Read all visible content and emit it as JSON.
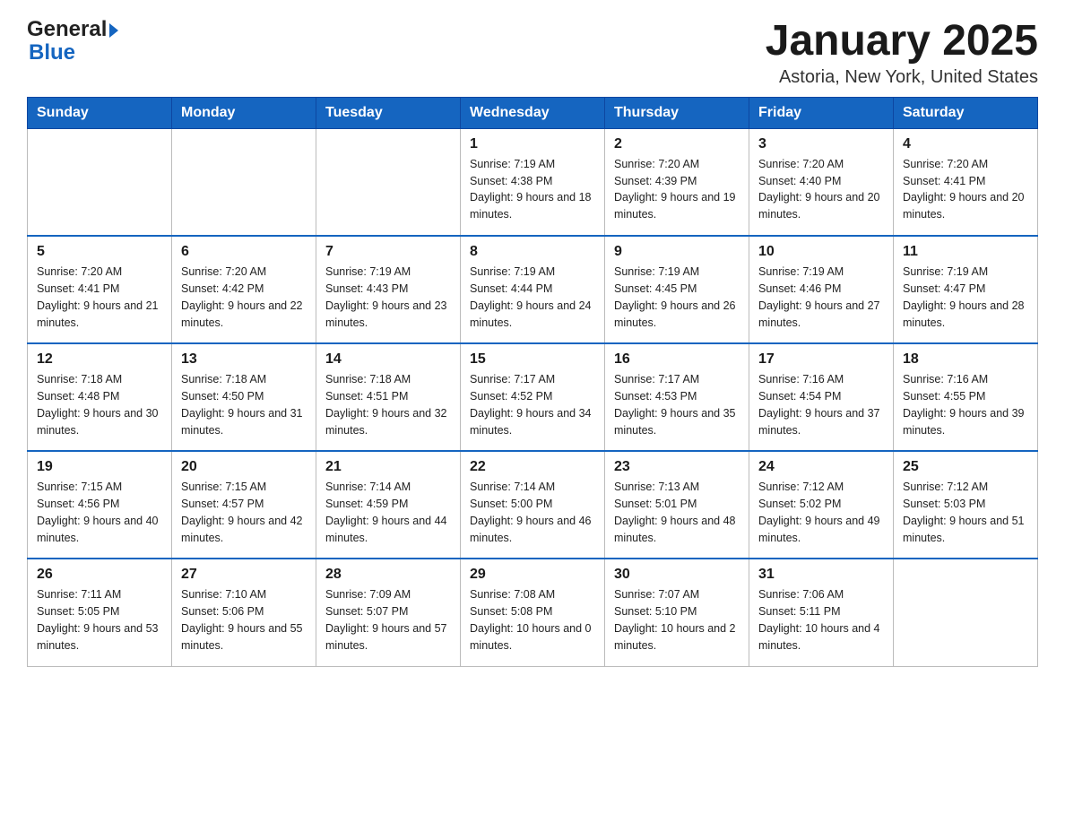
{
  "header": {
    "logo_line1": "General",
    "logo_line2": "Blue",
    "month_title": "January 2025",
    "location": "Astoria, New York, United States"
  },
  "days_of_week": [
    "Sunday",
    "Monday",
    "Tuesday",
    "Wednesday",
    "Thursday",
    "Friday",
    "Saturday"
  ],
  "weeks": [
    [
      {
        "day": "",
        "info": ""
      },
      {
        "day": "",
        "info": ""
      },
      {
        "day": "",
        "info": ""
      },
      {
        "day": "1",
        "info": "Sunrise: 7:19 AM\nSunset: 4:38 PM\nDaylight: 9 hours\nand 18 minutes."
      },
      {
        "day": "2",
        "info": "Sunrise: 7:20 AM\nSunset: 4:39 PM\nDaylight: 9 hours\nand 19 minutes."
      },
      {
        "day": "3",
        "info": "Sunrise: 7:20 AM\nSunset: 4:40 PM\nDaylight: 9 hours\nand 20 minutes."
      },
      {
        "day": "4",
        "info": "Sunrise: 7:20 AM\nSunset: 4:41 PM\nDaylight: 9 hours\nand 20 minutes."
      }
    ],
    [
      {
        "day": "5",
        "info": "Sunrise: 7:20 AM\nSunset: 4:41 PM\nDaylight: 9 hours\nand 21 minutes."
      },
      {
        "day": "6",
        "info": "Sunrise: 7:20 AM\nSunset: 4:42 PM\nDaylight: 9 hours\nand 22 minutes."
      },
      {
        "day": "7",
        "info": "Sunrise: 7:19 AM\nSunset: 4:43 PM\nDaylight: 9 hours\nand 23 minutes."
      },
      {
        "day": "8",
        "info": "Sunrise: 7:19 AM\nSunset: 4:44 PM\nDaylight: 9 hours\nand 24 minutes."
      },
      {
        "day": "9",
        "info": "Sunrise: 7:19 AM\nSunset: 4:45 PM\nDaylight: 9 hours\nand 26 minutes."
      },
      {
        "day": "10",
        "info": "Sunrise: 7:19 AM\nSunset: 4:46 PM\nDaylight: 9 hours\nand 27 minutes."
      },
      {
        "day": "11",
        "info": "Sunrise: 7:19 AM\nSunset: 4:47 PM\nDaylight: 9 hours\nand 28 minutes."
      }
    ],
    [
      {
        "day": "12",
        "info": "Sunrise: 7:18 AM\nSunset: 4:48 PM\nDaylight: 9 hours\nand 30 minutes."
      },
      {
        "day": "13",
        "info": "Sunrise: 7:18 AM\nSunset: 4:50 PM\nDaylight: 9 hours\nand 31 minutes."
      },
      {
        "day": "14",
        "info": "Sunrise: 7:18 AM\nSunset: 4:51 PM\nDaylight: 9 hours\nand 32 minutes."
      },
      {
        "day": "15",
        "info": "Sunrise: 7:17 AM\nSunset: 4:52 PM\nDaylight: 9 hours\nand 34 minutes."
      },
      {
        "day": "16",
        "info": "Sunrise: 7:17 AM\nSunset: 4:53 PM\nDaylight: 9 hours\nand 35 minutes."
      },
      {
        "day": "17",
        "info": "Sunrise: 7:16 AM\nSunset: 4:54 PM\nDaylight: 9 hours\nand 37 minutes."
      },
      {
        "day": "18",
        "info": "Sunrise: 7:16 AM\nSunset: 4:55 PM\nDaylight: 9 hours\nand 39 minutes."
      }
    ],
    [
      {
        "day": "19",
        "info": "Sunrise: 7:15 AM\nSunset: 4:56 PM\nDaylight: 9 hours\nand 40 minutes."
      },
      {
        "day": "20",
        "info": "Sunrise: 7:15 AM\nSunset: 4:57 PM\nDaylight: 9 hours\nand 42 minutes."
      },
      {
        "day": "21",
        "info": "Sunrise: 7:14 AM\nSunset: 4:59 PM\nDaylight: 9 hours\nand 44 minutes."
      },
      {
        "day": "22",
        "info": "Sunrise: 7:14 AM\nSunset: 5:00 PM\nDaylight: 9 hours\nand 46 minutes."
      },
      {
        "day": "23",
        "info": "Sunrise: 7:13 AM\nSunset: 5:01 PM\nDaylight: 9 hours\nand 48 minutes."
      },
      {
        "day": "24",
        "info": "Sunrise: 7:12 AM\nSunset: 5:02 PM\nDaylight: 9 hours\nand 49 minutes."
      },
      {
        "day": "25",
        "info": "Sunrise: 7:12 AM\nSunset: 5:03 PM\nDaylight: 9 hours\nand 51 minutes."
      }
    ],
    [
      {
        "day": "26",
        "info": "Sunrise: 7:11 AM\nSunset: 5:05 PM\nDaylight: 9 hours\nand 53 minutes."
      },
      {
        "day": "27",
        "info": "Sunrise: 7:10 AM\nSunset: 5:06 PM\nDaylight: 9 hours\nand 55 minutes."
      },
      {
        "day": "28",
        "info": "Sunrise: 7:09 AM\nSunset: 5:07 PM\nDaylight: 9 hours\nand 57 minutes."
      },
      {
        "day": "29",
        "info": "Sunrise: 7:08 AM\nSunset: 5:08 PM\nDaylight: 10 hours\nand 0 minutes."
      },
      {
        "day": "30",
        "info": "Sunrise: 7:07 AM\nSunset: 5:10 PM\nDaylight: 10 hours\nand 2 minutes."
      },
      {
        "day": "31",
        "info": "Sunrise: 7:06 AM\nSunset: 5:11 PM\nDaylight: 10 hours\nand 4 minutes."
      },
      {
        "day": "",
        "info": ""
      }
    ]
  ]
}
